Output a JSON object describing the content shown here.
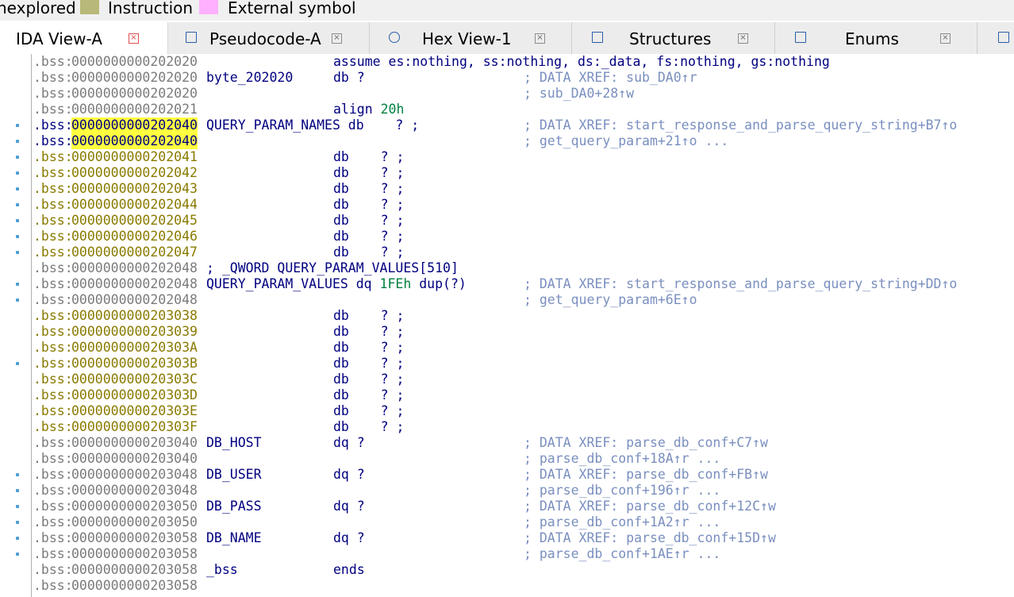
{
  "legend": [
    {
      "label": "nexplored",
      "color": ""
    },
    {
      "label": "Instruction",
      "color": "#b8b878"
    },
    {
      "label": "External symbol",
      "color": "#ffb0ff"
    }
  ],
  "tabs": [
    {
      "label": "IDA View-A",
      "icon": "",
      "active": true
    },
    {
      "label": "Pseudocode-A",
      "icon": "pseudocode-icon",
      "active": false
    },
    {
      "label": "Hex View-1",
      "icon": "hex-icon",
      "active": false
    },
    {
      "label": "Structures",
      "icon": "structures-icon",
      "active": false
    },
    {
      "label": "Enums",
      "icon": "enums-icon",
      "active": false
    },
    {
      "label": "",
      "icon": "imports-icon",
      "active": false
    }
  ],
  "close_glyph": "×",
  "colors": {
    "address_highlight": "#ffff40",
    "undefined_address": "#8a7a00",
    "keyword": "#000080",
    "comment": "#7a8fbf",
    "number": "#008040"
  },
  "code": {
    "lines": [
      {
        "seg": ".bss:",
        "addr": "0000000000202020",
        "label": "",
        "instr": "assume es:nothing, ss:nothing, ds:_data, fs:nothing, gs:nothing",
        "comment": "",
        "dot": false,
        "yellow": false
      },
      {
        "seg": ".bss:",
        "addr": "0000000000202020",
        "label": "byte_202020",
        "instr": "db ?",
        "comment": "; DATA XREF: sub_DA0↑r",
        "dot": false,
        "yellow": false
      },
      {
        "seg": ".bss:",
        "addr": "0000000000202020",
        "label": "",
        "instr": "",
        "comment": "; sub_DA0+28↑w",
        "dot": false,
        "yellow": false
      },
      {
        "seg": ".bss:",
        "addr": "0000000000202021",
        "label": "",
        "instr": "align 20h",
        "comment": "",
        "dot": false,
        "yellow": false
      },
      {
        "seg": ".bss:",
        "addr": "0000000000202040",
        "label": "QUERY_PARAM_NAMES db    ? ;",
        "instr": "",
        "comment": "; DATA XREF: start_response_and_parse_query_string+B7↑o",
        "dot": true,
        "yellow": false,
        "highlight": true
      },
      {
        "seg": ".bss:",
        "addr": "0000000000202040",
        "label": "",
        "instr": "",
        "comment": "; get_query_param+21↑o ...",
        "dot": true,
        "yellow": false,
        "highlight": true
      },
      {
        "seg": ".bss:",
        "addr": "0000000000202041",
        "label": "",
        "instr": "db    ? ;",
        "comment": "",
        "dot": true,
        "yellow": true
      },
      {
        "seg": ".bss:",
        "addr": "0000000000202042",
        "label": "",
        "instr": "db    ? ;",
        "comment": "",
        "dot": true,
        "yellow": true
      },
      {
        "seg": ".bss:",
        "addr": "0000000000202043",
        "label": "",
        "instr": "db    ? ;",
        "comment": "",
        "dot": true,
        "yellow": true
      },
      {
        "seg": ".bss:",
        "addr": "0000000000202044",
        "label": "",
        "instr": "db    ? ;",
        "comment": "",
        "dot": true,
        "yellow": true
      },
      {
        "seg": ".bss:",
        "addr": "0000000000202045",
        "label": "",
        "instr": "db    ? ;",
        "comment": "",
        "dot": true,
        "yellow": true
      },
      {
        "seg": ".bss:",
        "addr": "0000000000202046",
        "label": "",
        "instr": "db    ? ;",
        "comment": "",
        "dot": true,
        "yellow": true
      },
      {
        "seg": ".bss:",
        "addr": "0000000000202047",
        "label": "",
        "instr": "db    ? ;",
        "comment": "",
        "dot": true,
        "yellow": true
      },
      {
        "seg": ".bss:",
        "addr": "0000000000202048",
        "label": "; _QWORD QUERY_PARAM_VALUES[510]",
        "instr": "",
        "comment": "",
        "dot": false,
        "yellow": false
      },
      {
        "seg": ".bss:",
        "addr": "0000000000202048",
        "label": "QUERY_PARAM_VALUES dq ",
        "num": "1FEh",
        "rest": " dup(?)",
        "instr": "",
        "comment": "; DATA XREF: start_response_and_parse_query_string+DD↑o",
        "dot": true,
        "yellow": false
      },
      {
        "seg": ".bss:",
        "addr": "0000000000202048",
        "label": "",
        "instr": "",
        "comment": "; get_query_param+6E↑o",
        "dot": true,
        "yellow": false
      },
      {
        "seg": ".bss:",
        "addr": "0000000000203038",
        "label": "",
        "instr": "db    ? ;",
        "comment": "",
        "dot": false,
        "yellow": true
      },
      {
        "seg": ".bss:",
        "addr": "0000000000203039",
        "label": "",
        "instr": "db    ? ;",
        "comment": "",
        "dot": false,
        "yellow": true
      },
      {
        "seg": ".bss:",
        "addr": "000000000020303A",
        "label": "",
        "instr": "db    ? ;",
        "comment": "",
        "dot": false,
        "yellow": true
      },
      {
        "seg": ".bss:",
        "addr": "000000000020303B",
        "label": "",
        "instr": "db    ? ;",
        "comment": "",
        "dot": true,
        "yellow": true
      },
      {
        "seg": ".bss:",
        "addr": "000000000020303C",
        "label": "",
        "instr": "db    ? ;",
        "comment": "",
        "dot": false,
        "yellow": true
      },
      {
        "seg": ".bss:",
        "addr": "000000000020303D",
        "label": "",
        "instr": "db    ? ;",
        "comment": "",
        "dot": false,
        "yellow": true
      },
      {
        "seg": ".bss:",
        "addr": "000000000020303E",
        "label": "",
        "instr": "db    ? ;",
        "comment": "",
        "dot": false,
        "yellow": true
      },
      {
        "seg": ".bss:",
        "addr": "000000000020303F",
        "label": "",
        "instr": "db    ? ;",
        "comment": "",
        "dot": false,
        "yellow": true
      },
      {
        "seg": ".bss:",
        "addr": "0000000000203040",
        "label": "DB_HOST",
        "instr": "dq ?",
        "comment": "; DATA XREF: parse_db_conf+C7↑w",
        "dot": false,
        "yellow": false
      },
      {
        "seg": ".bss:",
        "addr": "0000000000203040",
        "label": "",
        "instr": "",
        "comment": "; parse_db_conf+18A↑r ...",
        "dot": false,
        "yellow": false
      },
      {
        "seg": ".bss:",
        "addr": "0000000000203048",
        "label": "DB_USER",
        "instr": "dq ?",
        "comment": "; DATA XREF: parse_db_conf+FB↑w",
        "dot": true,
        "yellow": false
      },
      {
        "seg": ".bss:",
        "addr": "0000000000203048",
        "label": "",
        "instr": "",
        "comment": "; parse_db_conf+196↑r ...",
        "dot": true,
        "yellow": false
      },
      {
        "seg": ".bss:",
        "addr": "0000000000203050",
        "label": "DB_PASS",
        "instr": "dq ?",
        "comment": "; DATA XREF: parse_db_conf+12C↑w",
        "dot": true,
        "yellow": false
      },
      {
        "seg": ".bss:",
        "addr": "0000000000203050",
        "label": "",
        "instr": "",
        "comment": "; parse_db_conf+1A2↑r ...",
        "dot": true,
        "yellow": false
      },
      {
        "seg": ".bss:",
        "addr": "0000000000203058",
        "label": "DB_NAME",
        "instr": "dq ?",
        "comment": "; DATA XREF: parse_db_conf+15D↑w",
        "dot": true,
        "yellow": false
      },
      {
        "seg": ".bss:",
        "addr": "0000000000203058",
        "label": "",
        "instr": "",
        "comment": "; parse_db_conf+1AE↑r ...",
        "dot": true,
        "yellow": false
      },
      {
        "seg": ".bss:",
        "addr": "0000000000203058",
        "label": "_bss",
        "instr": "ends",
        "comment": "",
        "dot": false,
        "yellow": false
      },
      {
        "seg": ".bss:",
        "addr": "0000000000203058",
        "label": "",
        "instr": "",
        "comment": "",
        "dot": false,
        "yellow": false
      }
    ]
  }
}
